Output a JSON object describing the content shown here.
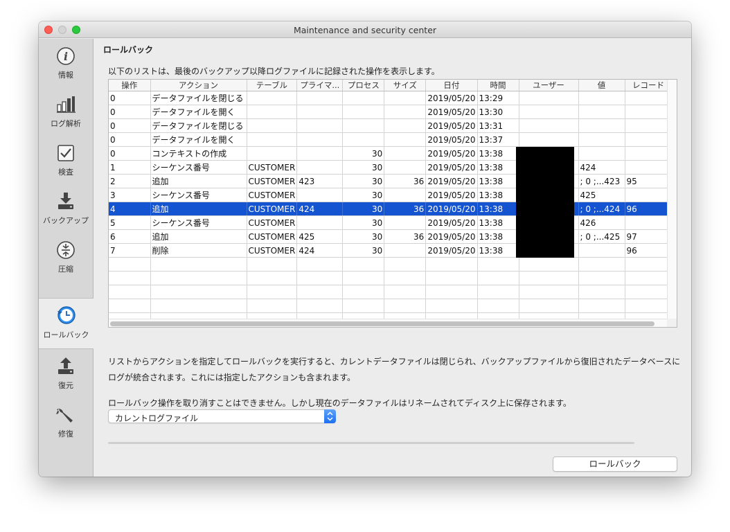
{
  "window": {
    "title": "Maintenance and security center"
  },
  "sidebar": {
    "items": [
      {
        "label": "情報",
        "icon": "info-icon"
      },
      {
        "label": "ログ解析",
        "icon": "bar-chart-icon"
      },
      {
        "label": "検査",
        "icon": "checkmark-icon"
      },
      {
        "label": "バックアップ",
        "icon": "backup-icon"
      },
      {
        "label": "圧縮",
        "icon": "compress-icon"
      },
      {
        "label": "ロールバック",
        "icon": "rollback-clock-icon"
      },
      {
        "label": "復元",
        "icon": "restore-icon"
      },
      {
        "label": "修復",
        "icon": "wrench-icon"
      }
    ],
    "active": "ロールバック"
  },
  "main": {
    "section_title": "ロールバック",
    "intro": "以下のリストは、最後のバックアップ以降ログファイルに記録された操作を表示します。",
    "table": {
      "columns": [
        "操作",
        "アクション",
        "テーブル",
        "プライマ...",
        "プロセス",
        "サイズ",
        "日付",
        "時間",
        "ユーザー",
        "値",
        "レコード"
      ],
      "rows": [
        [
          "0",
          "データファイルを閉じる",
          "",
          "",
          "",
          "",
          "2019/05/20",
          "13:29",
          "",
          "",
          ""
        ],
        [
          "0",
          "データファイルを開く",
          "",
          "",
          "",
          "",
          "2019/05/20",
          "13:30",
          "",
          "",
          ""
        ],
        [
          "0",
          "データファイルを閉じる",
          "",
          "",
          "",
          "",
          "2019/05/20",
          "13:31",
          "",
          "",
          ""
        ],
        [
          "0",
          "データファイルを開く",
          "",
          "",
          "",
          "",
          "2019/05/20",
          "13:37",
          "",
          "",
          ""
        ],
        [
          "0",
          "コンテキストの作成",
          "",
          "",
          "30",
          "",
          "2019/05/20",
          "13:38",
          "",
          "",
          ""
        ],
        [
          "1",
          "シーケンス番号",
          "CUSTOMER",
          "",
          "30",
          "",
          "2019/05/20",
          "13:38",
          "",
          "424",
          ""
        ],
        [
          "2",
          "追加",
          "CUSTOMER",
          "423",
          "30",
          "36",
          "2019/05/20",
          "13:38",
          "",
          "; 0 ;...423",
          "95"
        ],
        [
          "3",
          "シーケンス番号",
          "CUSTOMER",
          "",
          "30",
          "",
          "2019/05/20",
          "13:38",
          "",
          "425",
          ""
        ],
        [
          "4",
          "追加",
          "CUSTOMER",
          "424",
          "30",
          "36",
          "2019/05/20",
          "13:38",
          "",
          "; 0 ;...424",
          "96"
        ],
        [
          "5",
          "シーケンス番号",
          "CUSTOMER",
          "",
          "30",
          "",
          "2019/05/20",
          "13:38",
          "",
          "426",
          ""
        ],
        [
          "6",
          "追加",
          "CUSTOMER",
          "425",
          "30",
          "36",
          "2019/05/20",
          "13:38",
          "",
          "; 0 ;...425",
          "97"
        ],
        [
          "7",
          "削除",
          "CUSTOMER",
          "424",
          "30",
          "",
          "2019/05/20",
          "13:38",
          "",
          "",
          "96"
        ]
      ],
      "selected_row": 8,
      "empty_rows": 5
    },
    "description": "リストからアクションを指定してロールバックを実行すると、カレントデータファイルは閉じられ、バックアップファイルから復旧されたデータベースにログが統合されます。これには指定したアクションも含まれます。",
    "warning": "ロールバック操作を取り消すことはできません。しかし現在のデータファイルはリネームされてディスク上に保存されます。",
    "log_select": {
      "value": "カレントログファイル"
    },
    "rollback_button": "ロールバック"
  },
  "colors": {
    "selection": "#1554d0",
    "select_accent": "#1d6ff2"
  }
}
